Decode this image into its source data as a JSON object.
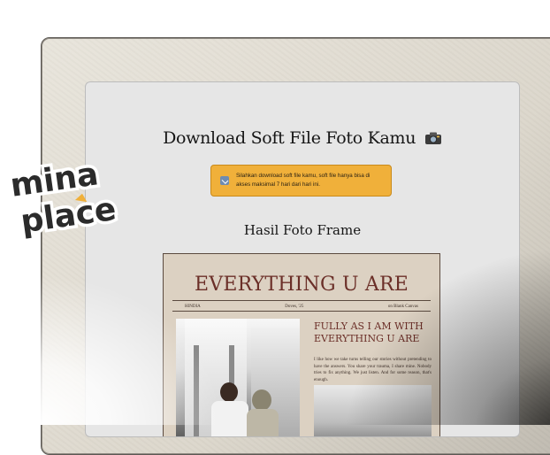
{
  "page": {
    "title": "Download Soft File Foto Kamu",
    "title_icon": "camera-icon",
    "notice": {
      "icon": "download-icon",
      "text": "Silahkan download soft file kamu, soft file hanya bisa di akses maksimal 7 hari dari hari ini."
    },
    "section_title": "Hasil Foto Frame"
  },
  "frame": {
    "headline": "EVERYTHING U ARE",
    "meta_left": "HINDIA",
    "meta_center": "Doves, '25",
    "meta_right": "on Blank Canvas",
    "subhead": "FULLY AS I AM WITH EVERYTHING U ARE",
    "body": "I like how we take turns telling our stories without pretending to have the answers. You share your trauma, I share mine. Nobody tries to fix anything. We just listen. And for some reason, that's enough."
  },
  "logo": {
    "line1": "mina",
    "line2": "place"
  },
  "colors": {
    "notice_bg": "#f0b03a",
    "headline": "#6b2f28",
    "paper": "#dcd1c2"
  }
}
